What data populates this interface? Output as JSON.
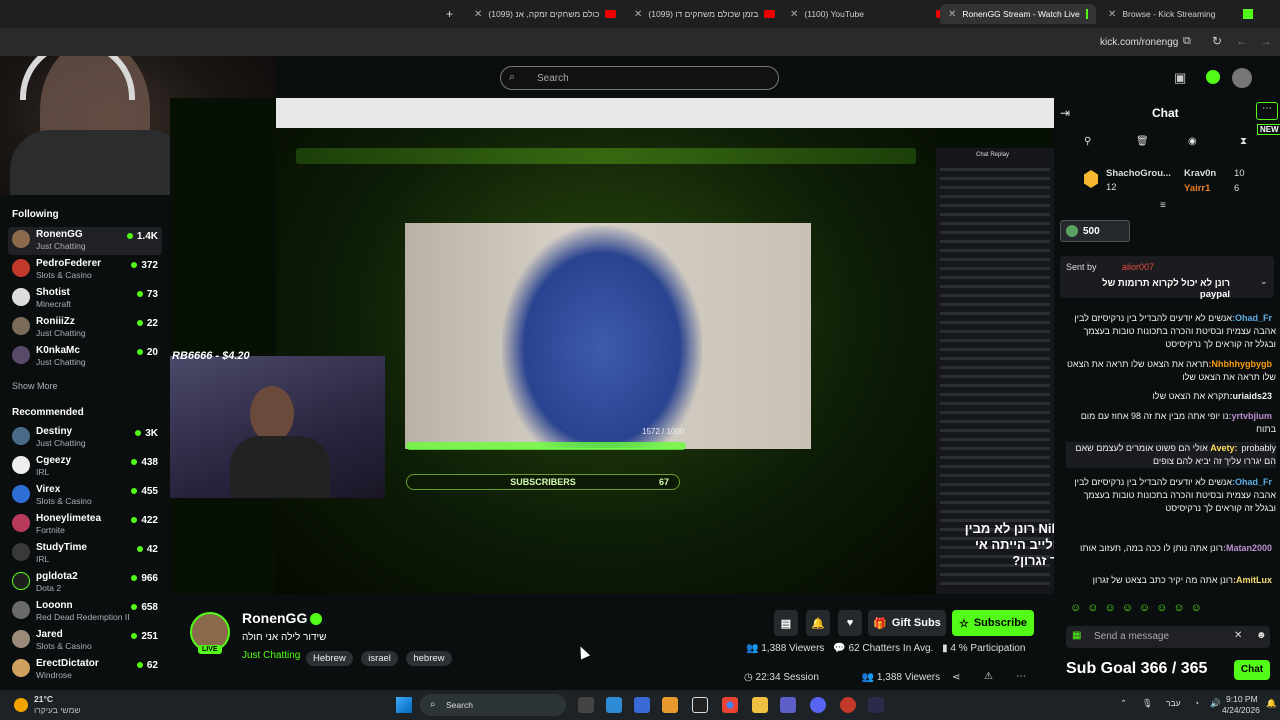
{
  "browser": {
    "tabs": [
      {
        "label": "(1099) כולם משחקים זמקה, אנ",
        "icon": "youtube-icon"
      },
      {
        "label": "(1099) בזמן שכולם משחקים דו",
        "icon": "youtube-icon"
      },
      {
        "label": "(1100) YouTube",
        "icon": "youtube-icon"
      },
      {
        "label": "RonenGG Stream - Watch Live",
        "icon": "kick-icon"
      },
      {
        "label": "Browse - Kick Streaming",
        "icon": "kick-icon"
      }
    ],
    "url": "kick.com/ronengg"
  },
  "header": {
    "search_placeholder": "Search"
  },
  "sidebar": {
    "following_title": "Following",
    "following": [
      {
        "name": "RonenGG",
        "category": "Just Chatting",
        "viewers": "1.4K"
      },
      {
        "name": "PedroFederer",
        "category": "Slots & Casino",
        "viewers": "372"
      },
      {
        "name": "Shotist",
        "category": "Minecraft",
        "viewers": "73"
      },
      {
        "name": "RoniiiZz",
        "category": "Just Chatting",
        "viewers": "22"
      },
      {
        "name": "K0nkaMc",
        "category": "Just Chatting",
        "viewers": "20"
      }
    ],
    "show_more": "Show More",
    "recommended_title": "Recommended",
    "recommended": [
      {
        "name": "Destiny",
        "category": "Just Chatting",
        "viewers": "3K"
      },
      {
        "name": "Cgeezy",
        "category": "IRL",
        "viewers": "438"
      },
      {
        "name": "Virex",
        "category": "Slots & Casino",
        "viewers": "455"
      },
      {
        "name": "Honeylimetea",
        "category": "Fortnite",
        "viewers": "422"
      },
      {
        "name": "StudyTime",
        "category": "IRL",
        "viewers": "42"
      },
      {
        "name": "pgldota2",
        "category": "Dota 2",
        "viewers": "966"
      },
      {
        "name": "Looonn",
        "category": "Red Dead Redemption II",
        "viewers": "658"
      },
      {
        "name": "Jared",
        "category": "Slots & Casino",
        "viewers": "251"
      },
      {
        "name": "ErectDictator",
        "category": "Windrose",
        "viewers": "62"
      }
    ]
  },
  "video": {
    "donation": "RB6666 - $4.20",
    "subscribers_label": "SUBSCRIBERS",
    "subscribers_count": "67",
    "progress": "1572 / 1000",
    "caption_user": "NikitaBarak",
    "caption_text": "רונן לא מבין שחלק מהלייב הייתה אי הבנה מצד זגרון?",
    "chat_replay_title": "Chat Replay"
  },
  "stream": {
    "channel": "RonenGG",
    "title": "שידור לילה אני חולה",
    "live_label": "LIVE",
    "category": "Just Chatting",
    "tags": [
      "Hebrew",
      "israel",
      "hebrew"
    ],
    "gift_subs": "Gift Subs",
    "subscribe": "Subscribe",
    "viewers": "1,388 Viewers",
    "chatters": "62 Chatters In Avg.",
    "participation": "4 % Participation",
    "session": "22:34 Session",
    "viewers_bottom": "1,388 Viewers"
  },
  "chat": {
    "title": "Chat",
    "new_badge": "NEW",
    "leaders": [
      {
        "name": "ShachoGrou...",
        "value": "12"
      },
      {
        "name": "Krav0n",
        "value": "10"
      },
      {
        "name": "Yairr1",
        "value": "6"
      }
    ],
    "kicks": "500",
    "pinned_by_label": "Sent by",
    "pinned_by_user": "alior007",
    "pinned_text": "רונן לא יכול לקרוא תרומות של paypal",
    "messages": [
      {
        "user": "Ohad_Fr:",
        "text": "אנשים לא יודעים להבדיל בין נרקיסיזם לבין אהבה עצמית ובסיטת והכרה בתכונות טובות בעצמך ובגלל זה קוראים לך נרקיסיסט",
        "color": "#5dade2"
      },
      {
        "user": "Nhbhhygbygb:",
        "text": "תראה את הצאט שלו תראה את הצאט שלו תראה את הצאט שלו",
        "color": "#f39c12"
      },
      {
        "user": "uriaids23:",
        "text": "תקרא את הצאט שלו",
        "color": "#efeff1"
      },
      {
        "user": "yrtvbjium:",
        "text": "נו יופי אתה מבין את זה 98 אחוז עם מום בתוח",
        "color": "#bb8fce"
      },
      {
        "user": "Avety:",
        "text": "probably אולי הם פשוט אומרים לעצמם שאם הם יגררו עליך זה יביא להם צופים",
        "color": "#ffde59"
      },
      {
        "user": "Ohad_Fr:",
        "text": "אנשים לא יודעים להבדיל בין נרקיסיזם לבין אהבה עצמית ובסיטת והכרה בתכונות טובות בעצמך ובגלל זה קוראים לך נרקיסיסט",
        "color": "#5dade2"
      },
      {
        "user": "Matan2000:",
        "text": "רונן אתה נותן לו ככה במה, תעזוב אותו",
        "color": "#bb8fce"
      },
      {
        "user": "AmitLux:",
        "text": "רונן אתה מה יקיר כתב בצאט של זגרון",
        "color": "#f7dc6f"
      }
    ],
    "input_placeholder": "Send a message",
    "send_label": "Chat",
    "sub_goal": "Sub Goal 366 / 365"
  },
  "taskbar": {
    "weather_temp": "21°C",
    "weather_desc": "שמשי בעיקרו",
    "search": "Search",
    "lang": "עבר",
    "time": "9:10 PM",
    "date": "4/24/2026"
  }
}
